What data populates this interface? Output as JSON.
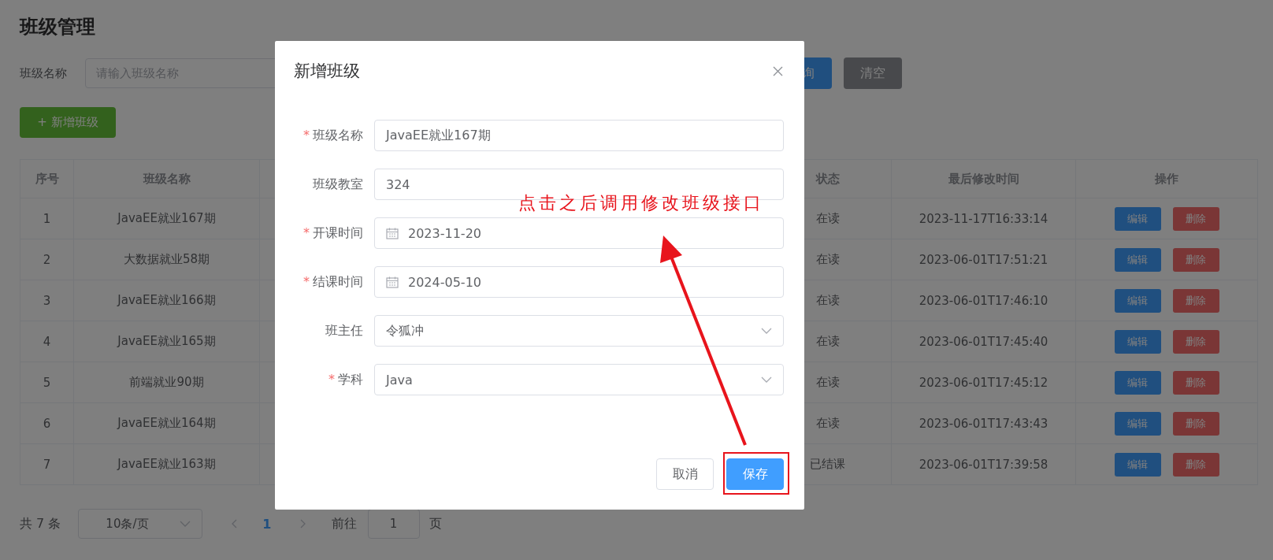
{
  "page": {
    "title": "班级管理",
    "filter": {
      "label": "班级名称",
      "placeholder": "请输入班级名称"
    },
    "query_button": "询",
    "clear_button": "清空",
    "add_button": "+ 新增班级",
    "table": {
      "columns": [
        "序号",
        "班级名称",
        "状态",
        "最后修改时间",
        "操作"
      ],
      "rows": [
        {
          "index": "1",
          "name": "JavaEE就业167期",
          "status": "在读",
          "updated": "2023-11-17T16:33:14",
          "actions": [
            "编辑",
            "删除"
          ]
        },
        {
          "index": "2",
          "name": "大数据就业58期",
          "status": "在读",
          "updated": "2023-06-01T17:51:21",
          "actions": [
            "编辑",
            "删除"
          ]
        },
        {
          "index": "3",
          "name": "JavaEE就业166期",
          "status": "在读",
          "updated": "2023-06-01T17:46:10",
          "actions": [
            "编辑",
            "删除"
          ]
        },
        {
          "index": "4",
          "name": "JavaEE就业165期",
          "status": "在读",
          "updated": "2023-06-01T17:45:40",
          "actions": [
            "编辑",
            "删除"
          ]
        },
        {
          "index": "5",
          "name": "前端就业90期",
          "status": "在读",
          "updated": "2023-06-01T17:45:12",
          "actions": [
            "编辑",
            "删除"
          ]
        },
        {
          "index": "6",
          "name": "JavaEE就业164期",
          "status": "在读",
          "updated": "2023-06-01T17:43:43",
          "actions": [
            "编辑",
            "删除"
          ]
        },
        {
          "index": "7",
          "name": "JavaEE就业163期",
          "status": "已结课",
          "updated": "2023-06-01T17:39:58",
          "actions": [
            "编辑",
            "删除"
          ]
        }
      ]
    },
    "pagination": {
      "total": "共 7 条",
      "page_size": "10条/页",
      "pages": [
        {
          "label": "1",
          "selected": true
        }
      ],
      "goto_label": "前往",
      "goto_value": "1",
      "page_unit": "页"
    }
  },
  "dialog": {
    "title": "新增班级",
    "fields": [
      {
        "label": "班级名称",
        "mark": "*",
        "kind": "text",
        "value": "JavaEE就业167期"
      },
      {
        "label": "班级教室",
        "kind": "text",
        "value": "324"
      },
      {
        "label": "开课时间",
        "mark": "*",
        "kind": "date",
        "value": "2023-11-20"
      },
      {
        "label": "结课时间",
        "mark": "*",
        "kind": "date",
        "value": "2024-05-10"
      },
      {
        "label": "班主任",
        "kind": "select",
        "value": "令狐冲"
      },
      {
        "label": "学科",
        "mark": "*",
        "kind": "select",
        "value": "Java"
      }
    ],
    "buttons": [
      {
        "label": "取消",
        "kind": "default"
      },
      {
        "label": "保存",
        "kind": "primary"
      }
    ]
  },
  "annotation": {
    "text": "点击之后调用修改班级接口"
  }
}
